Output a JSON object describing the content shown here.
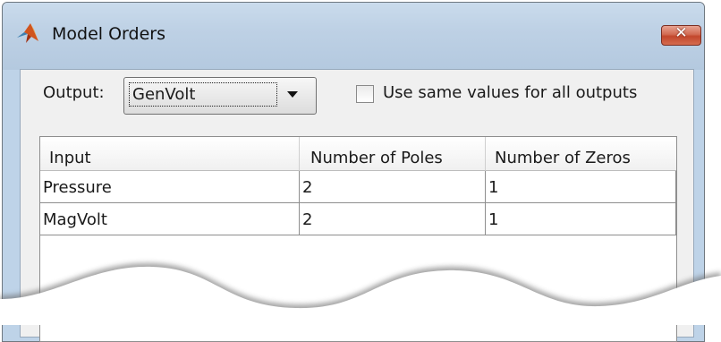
{
  "window": {
    "title": "Model Orders",
    "close_glyph": "✕",
    "icon": "matlab-logo-icon"
  },
  "output": {
    "label": "Output:",
    "selected": "GenVolt"
  },
  "same_values": {
    "label": "Use same values for all outputs",
    "checked": false
  },
  "table": {
    "columns": [
      "Input",
      "Number of Poles",
      "Number of Zeros"
    ],
    "rows": [
      [
        "Pressure",
        "2",
        "1"
      ],
      [
        "MagVolt",
        "2",
        "1"
      ]
    ]
  },
  "colors": {
    "titlebar": "#bed1e5",
    "close_button": "#c2472c",
    "client_bg": "#f0f0f0"
  }
}
